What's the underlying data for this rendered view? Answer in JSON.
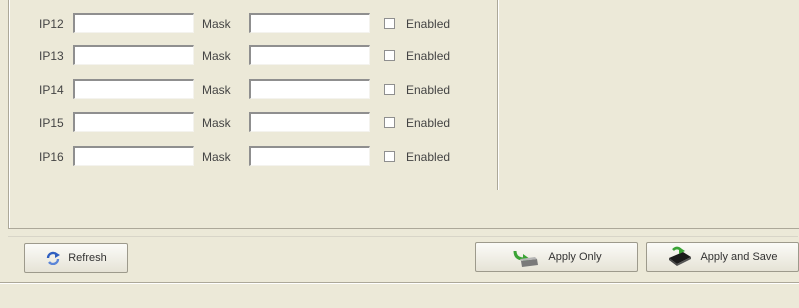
{
  "ip_rows": [
    {
      "ip_label": "IP12",
      "ip_value": "",
      "mask_label": "Mask",
      "mask_value": "",
      "enabled_label": "Enabled",
      "enabled": false
    },
    {
      "ip_label": "IP13",
      "ip_value": "",
      "mask_label": "Mask",
      "mask_value": "",
      "enabled_label": "Enabled",
      "enabled": false
    },
    {
      "ip_label": "IP14",
      "ip_value": "",
      "mask_label": "Mask",
      "mask_value": "",
      "enabled_label": "Enabled",
      "enabled": false
    },
    {
      "ip_label": "IP15",
      "ip_value": "",
      "mask_label": "Mask",
      "mask_value": "",
      "enabled_label": "Enabled",
      "enabled": false
    },
    {
      "ip_label": "IP16",
      "ip_value": "",
      "mask_label": "Mask",
      "mask_value": "",
      "enabled_label": "Enabled",
      "enabled": false
    }
  ],
  "toolbar": {
    "refresh_label": "Refresh",
    "refresh_icon": "refresh-icon",
    "apply_only_label": "Apply Only",
    "apply_only_icon": "apply-icon",
    "apply_save_label": "Apply and Save",
    "apply_save_icon": "save-icon"
  },
  "colors": {
    "background": "#ECE9D8",
    "accent_green": "#3aa335",
    "refresh_blue": "#2f5fc0"
  }
}
